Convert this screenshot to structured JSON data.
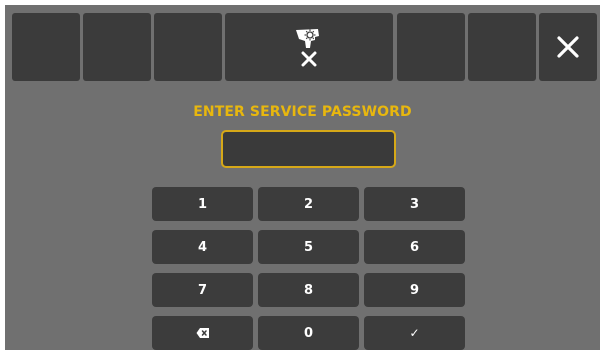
{
  "prompt": {
    "title": "ENTER SERVICE PASSWORD"
  },
  "password_field": {
    "value": "",
    "placeholder": ""
  },
  "header": {
    "service_icon": "service-tool-icon",
    "cancel_icon": "x-icon",
    "close_icon": "close-icon"
  },
  "keypad": {
    "keys": [
      "1",
      "2",
      "3",
      "4",
      "5",
      "6",
      "7",
      "8",
      "9",
      "",
      "0",
      "✓"
    ],
    "backspace_icon": "backspace-icon"
  },
  "colors": {
    "background": "#707070",
    "button": "#3b3b3b",
    "accent": "#e8b70e",
    "text": "#ffffff"
  }
}
